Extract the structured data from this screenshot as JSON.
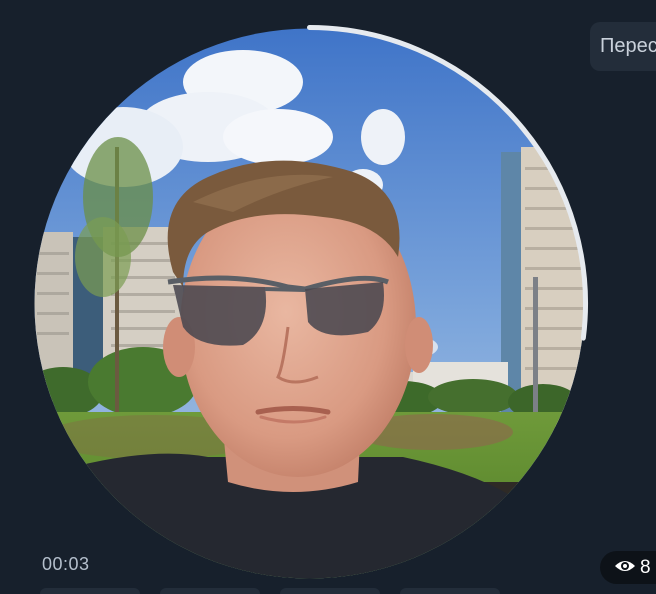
{
  "message": {
    "forward_label": "Переслать",
    "duration": "00:03",
    "views": "8"
  },
  "video": {
    "progress_fraction": 0.27,
    "scene_content": "selfie-portrait"
  },
  "colors": {
    "background": "#17202c",
    "chip_background": "#232d3a",
    "ring": "#e6eaef",
    "views_pill": "#0d1218"
  },
  "icons": {
    "views": "eye-icon"
  }
}
